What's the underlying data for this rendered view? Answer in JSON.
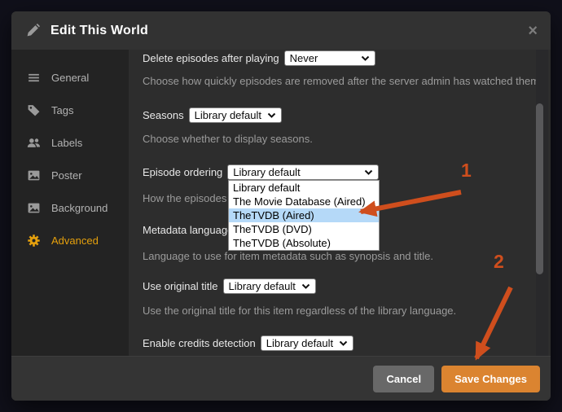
{
  "window": {
    "title": "Edit This World",
    "close_glyph": "×"
  },
  "sidebar": {
    "items": [
      {
        "label": "General"
      },
      {
        "label": "Tags"
      },
      {
        "label": "Labels"
      },
      {
        "label": "Poster"
      },
      {
        "label": "Background"
      },
      {
        "label": "Advanced",
        "active": true
      }
    ]
  },
  "form": {
    "rows": [
      {
        "label": "Delete episodes after playing",
        "value": "Never",
        "description": "Choose how quickly episodes are removed after the server admin has watched them."
      },
      {
        "label": "Seasons",
        "value": "Library default",
        "description": "Choose whether to display seasons."
      },
      {
        "label": "Episode ordering",
        "value": "Library default",
        "description": "How the episodes"
      },
      {
        "label": "Metadata language",
        "value": "",
        "description": "Language to use for item metadata such as synopsis and title."
      },
      {
        "label": "Use original title",
        "value": "Library default",
        "description": "Use the original title for this item regardless of the library language."
      },
      {
        "label": "Enable credits detection",
        "value": "Library default",
        "description": ""
      }
    ],
    "dropdown": {
      "options": [
        "Library default",
        "The Movie Database (Aired)",
        "TheTVDB (Aired)",
        "TheTVDB (DVD)",
        "TheTVDB (Absolute)"
      ],
      "highlighted": "TheTVDB (Aired)",
      "highlight_color": "#b5d9f8"
    }
  },
  "footer": {
    "cancel_label": "Cancel",
    "save_label": "Save Changes"
  },
  "annotations": {
    "step1": "1",
    "step2": "2",
    "arrow_color": "#cf4e1d"
  },
  "colors": {
    "accent": "#e5a00d",
    "save_button": "#db8430",
    "cancel_button": "#686868",
    "modal_bg": "#2d2d2d",
    "sidebar_bg": "#232323",
    "page_bg": "#10101a"
  }
}
